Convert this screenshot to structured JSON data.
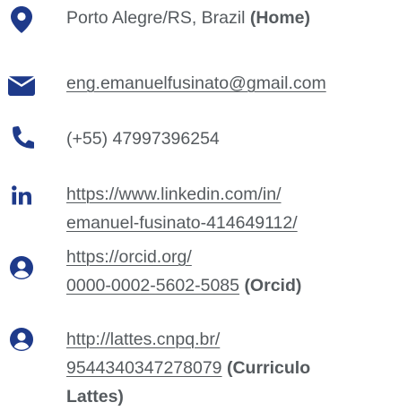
{
  "accent_color": "#1e3a8a",
  "text_color": "#555a5e",
  "contacts": {
    "home": {
      "icon": "map-marker-icon",
      "text": "Porto Alegre/RS, Brazil",
      "suffix": "(Home)"
    },
    "email": {
      "icon": "envelope-icon",
      "text": "eng.emanuelfusinato@gmail.com"
    },
    "phone": {
      "icon": "phone-icon",
      "text": "(+55) 47997396254"
    },
    "linkedin": {
      "icon": "linkedin-icon",
      "line1": "https://www.linkedin.com/in/",
      "line2": "emanuel-fusinato-414649112/"
    },
    "orcid": {
      "icon": "user-circle-icon",
      "line1": "https://orcid.org/",
      "line2": "0000-0002-5602-5085",
      "suffix": "(Orcid)"
    },
    "lattes": {
      "icon": "user-circle-icon",
      "line1": "http://lattes.cnpq.br/",
      "line2": "9544340347278079",
      "suffix_line2": "(Curriculo",
      "suffix_line3": "Lattes)"
    }
  }
}
